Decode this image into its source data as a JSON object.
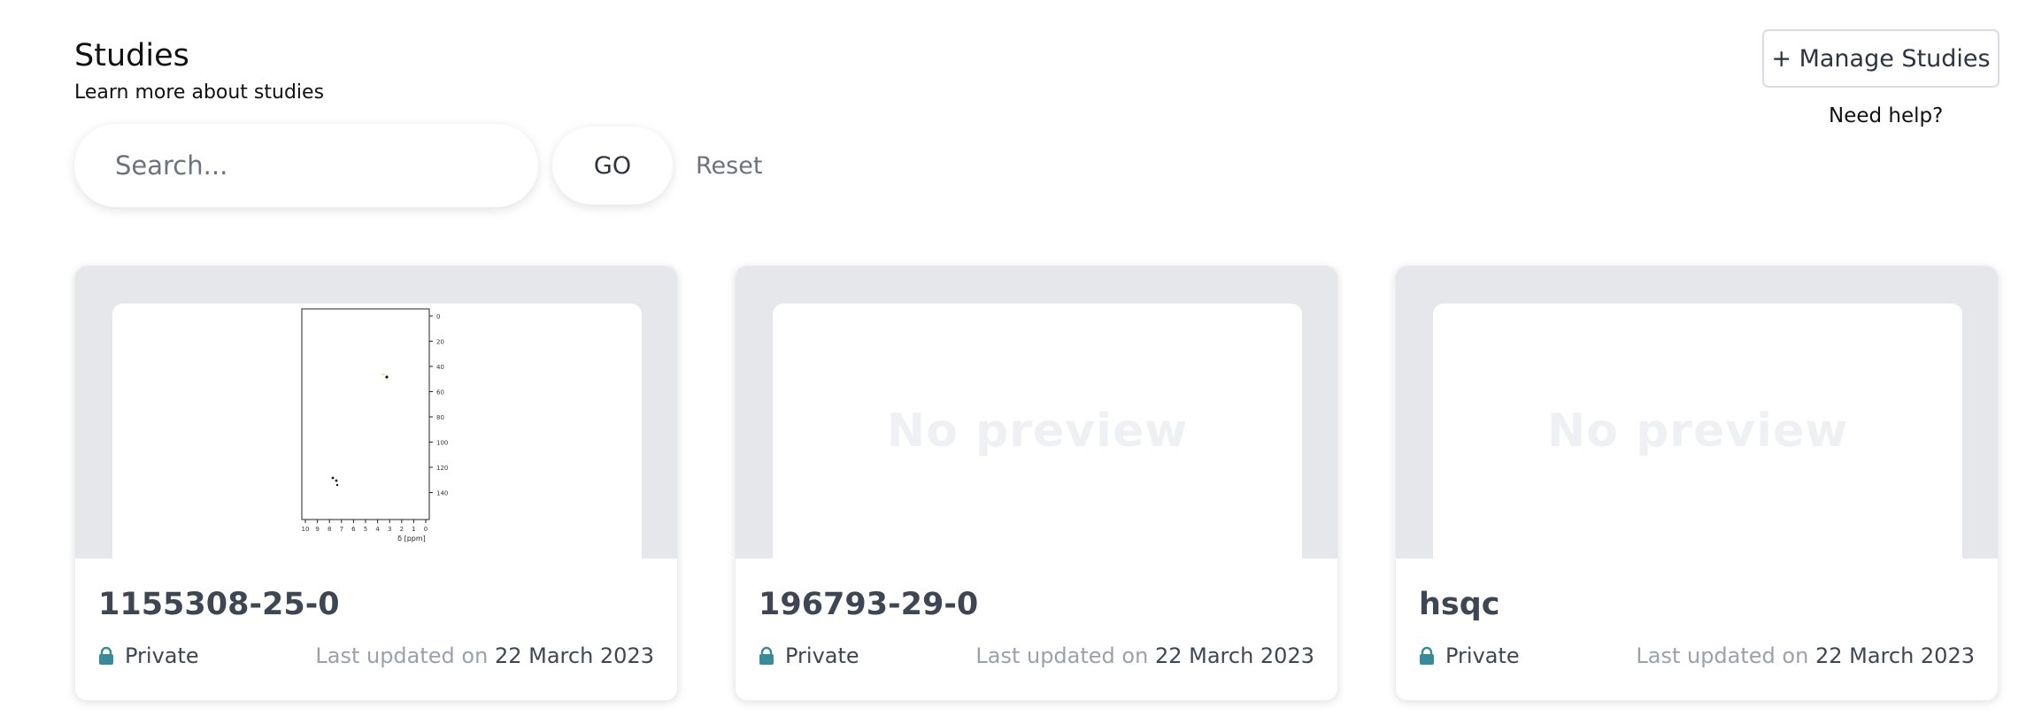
{
  "header": {
    "title": "Studies",
    "subtitle": "Learn more about studies"
  },
  "actions": {
    "manage_label": "+ Manage Studies",
    "help_label": "Need help?"
  },
  "search": {
    "placeholder": "Search...",
    "value": "",
    "go_label": "GO",
    "reset_label": "Reset"
  },
  "cards": [
    {
      "title": "1155308-25-0",
      "visibility": "Private",
      "updated_prefix": "Last updated on",
      "updated_date": "22 March 2023",
      "preview": "spectrum",
      "preview_plot": {
        "y_ticks": [
          "0",
          "20",
          "40",
          "60",
          "80",
          "100",
          "120",
          "140"
        ],
        "x_ticks": [
          "10",
          "9",
          "8",
          "7",
          "6",
          "5",
          "4",
          "3",
          "2",
          "1",
          "0"
        ],
        "x_label": "δ [ppm]"
      }
    },
    {
      "title": "196793-29-0",
      "visibility": "Private",
      "updated_prefix": "Last updated on",
      "updated_date": "22 March 2023",
      "preview": "none",
      "no_preview_text": "No preview"
    },
    {
      "title": "hsqc",
      "visibility": "Private",
      "updated_prefix": "Last updated on",
      "updated_date": "22 March 2023",
      "preview": "none",
      "no_preview_text": "No preview"
    }
  ],
  "colors": {
    "accent_lock": "#3b8a9c",
    "card_header_bg": "#e5e7eb"
  }
}
